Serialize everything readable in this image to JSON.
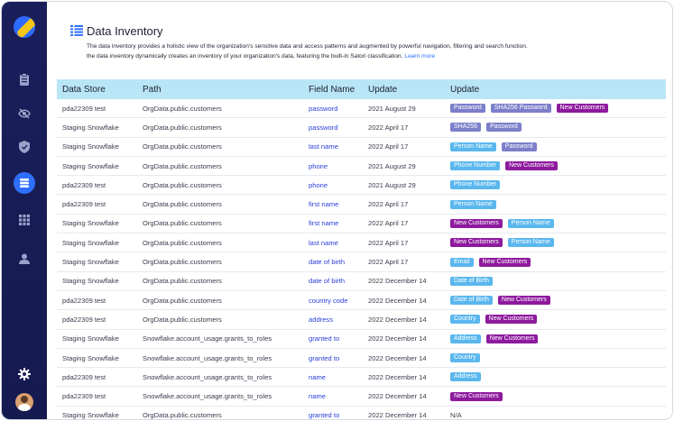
{
  "sidebar": {
    "logo": "satori-logo",
    "icons": [
      "clipboard-icon",
      "eye-off-icon",
      "shield-icon",
      "database-icon",
      "grid-icon",
      "user-icon",
      "gear-icon"
    ],
    "active": "database-icon"
  },
  "header": {
    "title": "Data Inventory",
    "description_line1": "The data inventory provides a holistic view of the organization's sensitive data and access patterns and augmented by powerful navigation, filtering and search function.",
    "description_line2": "the data inventory dynamically creates an inventory of your organization's data, featuring the built-in Satori classification.",
    "learn_more": "Learn more"
  },
  "table": {
    "columns": [
      "Data Store",
      "Path",
      "Field Name",
      "Update",
      "Update"
    ],
    "rows": [
      {
        "store": "pda22309 test",
        "path": "OrgData.public.customers",
        "field": "password",
        "update": "2021 August 29",
        "tags": [
          {
            "label": "Password",
            "color": "lav"
          },
          {
            "label": "SHA256 Password",
            "color": "lav"
          },
          {
            "label": "New Customers",
            "color": "purple"
          }
        ]
      },
      {
        "store": "Staging Snowflake",
        "path": "OrgData.public.customers",
        "field": "password",
        "update": "2022 April 17",
        "tags": [
          {
            "label": "SHA256",
            "color": "lav"
          },
          {
            "label": "Password",
            "color": "lav"
          }
        ]
      },
      {
        "store": "Staging Snowflake",
        "path": "OrgData.public.customers",
        "field": "last name",
        "update": "2022 April 17",
        "tags": [
          {
            "label": "Person Name",
            "color": "blue"
          },
          {
            "label": "Password",
            "color": "lav"
          }
        ]
      },
      {
        "store": "Staging Snowflake",
        "path": "OrgData.public.customers",
        "field": "phone",
        "update": "2021 August 29",
        "tags": [
          {
            "label": "Phone Number",
            "color": "blue"
          },
          {
            "label": "New Customers",
            "color": "purple"
          }
        ]
      },
      {
        "store": "pda22309 test",
        "path": "OrgData.public.customers",
        "field": "phone",
        "update": "2021 August 29",
        "tags": [
          {
            "label": "Phone Number",
            "color": "blue"
          }
        ]
      },
      {
        "store": "pda22309 test",
        "path": "OrgData.public.customers",
        "field": "first name",
        "update": "2022 April 17",
        "tags": [
          {
            "label": "Person Name",
            "color": "blue"
          }
        ]
      },
      {
        "store": "Staging Snowflake",
        "path": "OrgData.public.customers",
        "field": "first name",
        "update": "2022 April 17",
        "tags": [
          {
            "label": "New Customers",
            "color": "purple"
          },
          {
            "label": "Person Name",
            "color": "blue"
          }
        ]
      },
      {
        "store": "Staging Snowflake",
        "path": "OrgData.public.customers",
        "field": "last name",
        "update": "2022 April 17",
        "tags": [
          {
            "label": "New Customers",
            "color": "purple"
          },
          {
            "label": "Person Name",
            "color": "blue"
          }
        ]
      },
      {
        "store": "Staging Snowflake",
        "path": "OrgData.public.customers",
        "field": "date of birth",
        "update": "2022 April 17",
        "tags": [
          {
            "label": "Email",
            "color": "blue"
          },
          {
            "label": "New Customers",
            "color": "purple"
          }
        ]
      },
      {
        "store": "Staging Snowflake",
        "path": "OrgData.public.customers",
        "field": "date of birth",
        "update": "2022 December 14",
        "tags": [
          {
            "label": "Date of Birth",
            "color": "blue"
          }
        ]
      },
      {
        "store": "pda22309 test",
        "path": "OrgData.public.customers",
        "field": "country code",
        "update": "2022 December 14",
        "tags": [
          {
            "label": "Date of Birth",
            "color": "blue"
          },
          {
            "label": "New Customers",
            "color": "purple"
          }
        ]
      },
      {
        "store": "pda22309 test",
        "path": "OrgData.public.customers",
        "field": "address",
        "update": "2022 December 14",
        "tags": [
          {
            "label": "Country",
            "color": "blue"
          },
          {
            "label": "New Customers",
            "color": "purple"
          }
        ]
      },
      {
        "store": "Staging Snowflake",
        "path": "Snowflake.account_usage.grants_to_roles",
        "field": "granted to",
        "update": "2022 December 14",
        "tags": [
          {
            "label": "Address",
            "color": "blue"
          },
          {
            "label": "New Customers",
            "color": "purple"
          }
        ]
      },
      {
        "store": "Staging Snowflake",
        "path": "Snowflake.account_usage.grants_to_roles",
        "field": "granted to",
        "update": "2022 December 14",
        "tags": [
          {
            "label": "Country",
            "color": "blue"
          }
        ]
      },
      {
        "store": "pda22309 test",
        "path": "Snowflake.account_usage.grants_to_roles",
        "field": "name",
        "update": "2022 December 14",
        "tags": [
          {
            "label": "Address",
            "color": "blue"
          }
        ]
      },
      {
        "store": "pda22309 test",
        "path": "Snowflake.account_usage.grants_to_roles",
        "field": "name",
        "update": "2022 December 14",
        "tags": [
          {
            "label": "New Customers",
            "color": "purple"
          }
        ]
      },
      {
        "store": "Staging Snowflake",
        "path": "OrgData.public.customers",
        "field": "granted to",
        "update": "2022 December 14",
        "tags": [],
        "na": "N/A"
      }
    ]
  },
  "colors": {
    "sidebar_bg": "#1a1f5c",
    "header_row_bg": "#b9e6f7",
    "tag_lavender": "#7c7fc9",
    "tag_blue": "#5ab7ee",
    "tag_purple": "#8e1a9e",
    "link": "#2f6fff"
  }
}
